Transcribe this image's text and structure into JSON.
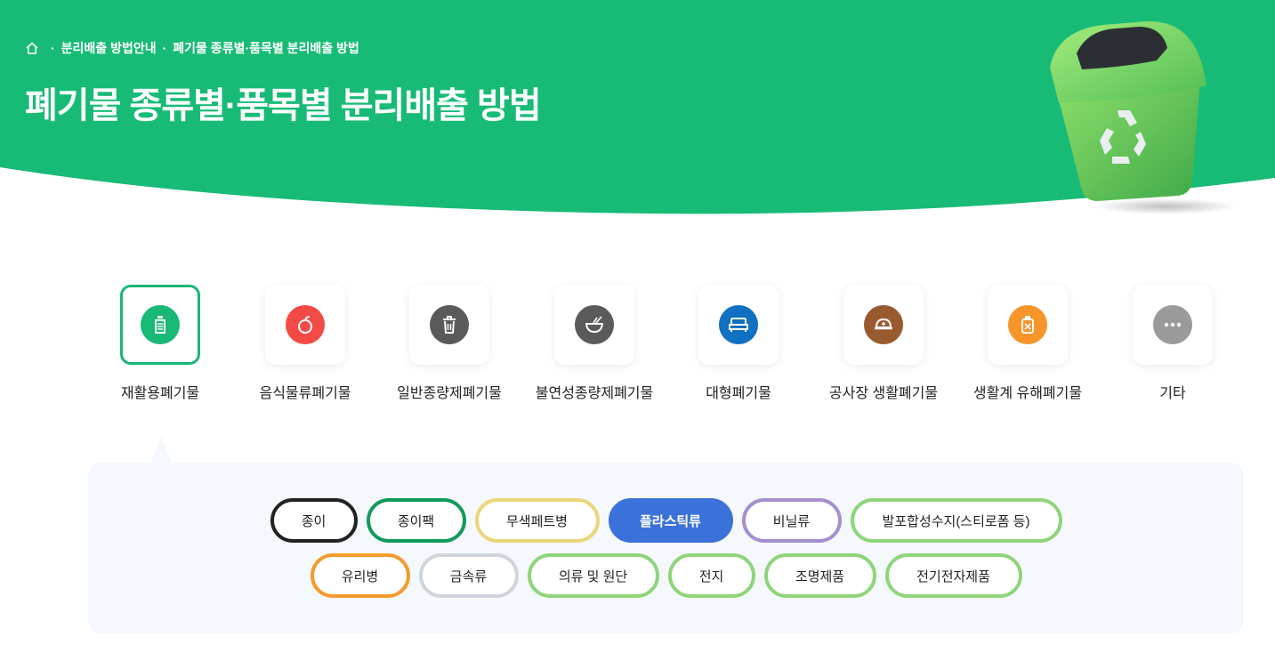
{
  "breadcrumb": {
    "items": [
      "분리배출 방법안내",
      "폐기물 종류별·품목별 분리배출 방법"
    ],
    "separator": "·"
  },
  "page_title": "폐기물 종류별·품목별 분리배출 방법",
  "colors": {
    "brand": "#18bb76",
    "panel_bg": "#f5f8fc"
  },
  "categories": [
    {
      "label": "재활용폐기물",
      "icon": "bottle-icon",
      "color": "#18b876",
      "active": true
    },
    {
      "label": "음식물류폐기물",
      "icon": "apple-icon",
      "color": "#f44a45",
      "active": false
    },
    {
      "label": "일반종량제폐기물",
      "icon": "trash-icon",
      "color": "#5a5a5a",
      "active": false
    },
    {
      "label": "불연성종량제폐기물",
      "icon": "bowl-icon",
      "color": "#5a5a5a",
      "active": false
    },
    {
      "label": "대형폐기물",
      "icon": "bed-icon",
      "color": "#1070c2",
      "active": false
    },
    {
      "label": "공사장 생활폐기물",
      "icon": "helmet-icon",
      "color": "#9a5a30",
      "active": false
    },
    {
      "label": "생활계 유해폐기물",
      "icon": "hazard-bottle-icon",
      "color": "#f7952b",
      "active": false
    },
    {
      "label": "기타",
      "icon": "more-icon",
      "color": "#9a9a9a",
      "active": false
    }
  ],
  "items_row1": [
    {
      "label": "종이",
      "border": "#222222"
    },
    {
      "label": "종이팩",
      "border": "#129a5c"
    },
    {
      "label": "무색페트병",
      "border": "#ead67a"
    },
    {
      "label": "플라스틱류",
      "border": "#3b72d9",
      "active": true
    },
    {
      "label": "비닐류",
      "border": "#a68fd0"
    },
    {
      "label": "발포합성수지(스티로폼 등)",
      "border": "#8fd47a"
    }
  ],
  "items_row2": [
    {
      "label": "유리병",
      "border": "#f79a2c"
    },
    {
      "label": "금속류",
      "border": "#cfd5dc"
    },
    {
      "label": "의류 및 원단",
      "border": "#8fd47a"
    },
    {
      "label": "전지",
      "border": "#8fd47a"
    },
    {
      "label": "조명제품",
      "border": "#8fd47a"
    },
    {
      "label": "전기전자제품",
      "border": "#8fd47a"
    }
  ]
}
